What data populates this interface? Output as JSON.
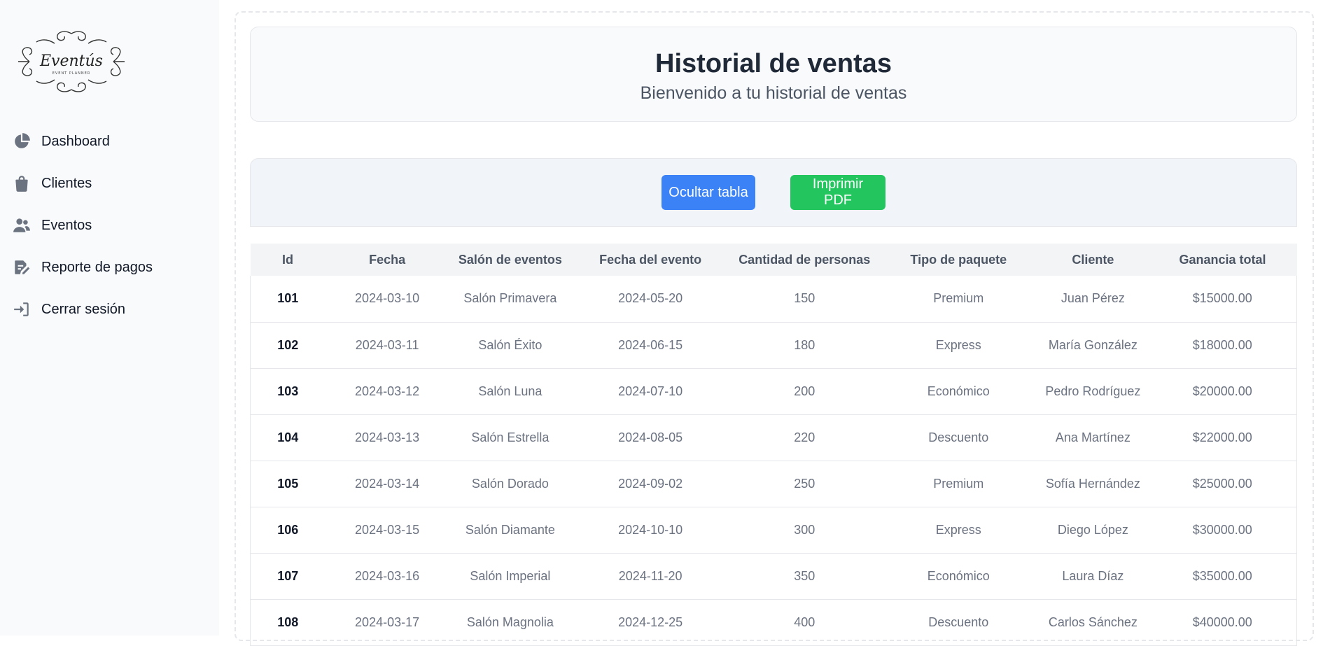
{
  "sidebar": {
    "logo_text": "Eventús",
    "logo_subtext": "EVENT PLANNER",
    "items": [
      {
        "label": "Dashboard",
        "icon": "pie-chart-icon"
      },
      {
        "label": "Clientes",
        "icon": "shopping-bag-icon"
      },
      {
        "label": "Eventos",
        "icon": "users-icon"
      },
      {
        "label": "Reporte de pagos",
        "icon": "edit-document-icon"
      },
      {
        "label": "Cerrar sesión",
        "icon": "sign-in-icon"
      }
    ]
  },
  "header": {
    "title": "Historial de ventas",
    "subtitle": "Bienvenido a tu historial de ventas"
  },
  "toolbar": {
    "hide_label": "Ocultar tabla",
    "print_label": "Imprimir PDF"
  },
  "table": {
    "columns": [
      "Id",
      "Fecha",
      "Salón de eventos",
      "Fecha del evento",
      "Cantidad de personas",
      "Tipo de paquete",
      "Cliente",
      "Ganancia total"
    ],
    "rows": [
      [
        "101",
        "2024-03-10",
        "Salón Primavera",
        "2024-05-20",
        "150",
        "Premium",
        "Juan Pérez",
        "$15000.00"
      ],
      [
        "102",
        "2024-03-11",
        "Salón Éxito",
        "2024-06-15",
        "180",
        "Express",
        "María González",
        "$18000.00"
      ],
      [
        "103",
        "2024-03-12",
        "Salón Luna",
        "2024-07-10",
        "200",
        "Económico",
        "Pedro Rodríguez",
        "$20000.00"
      ],
      [
        "104",
        "2024-03-13",
        "Salón Estrella",
        "2024-08-05",
        "220",
        "Descuento",
        "Ana Martínez",
        "$22000.00"
      ],
      [
        "105",
        "2024-03-14",
        "Salón Dorado",
        "2024-09-02",
        "250",
        "Premium",
        "Sofía Hernández",
        "$25000.00"
      ],
      [
        "106",
        "2024-03-15",
        "Salón Diamante",
        "2024-10-10",
        "300",
        "Express",
        "Diego López",
        "$30000.00"
      ],
      [
        "107",
        "2024-03-16",
        "Salón Imperial",
        "2024-11-20",
        "350",
        "Económico",
        "Laura Díaz",
        "$35000.00"
      ],
      [
        "108",
        "2024-03-17",
        "Salón Magnolia",
        "2024-12-25",
        "400",
        "Descuento",
        "Carlos Sánchez",
        "$40000.00"
      ]
    ]
  },
  "colors": {
    "primary_button": "#3b82f6",
    "success_button": "#22c55e",
    "sidebar_bg": "#f9fafb"
  }
}
